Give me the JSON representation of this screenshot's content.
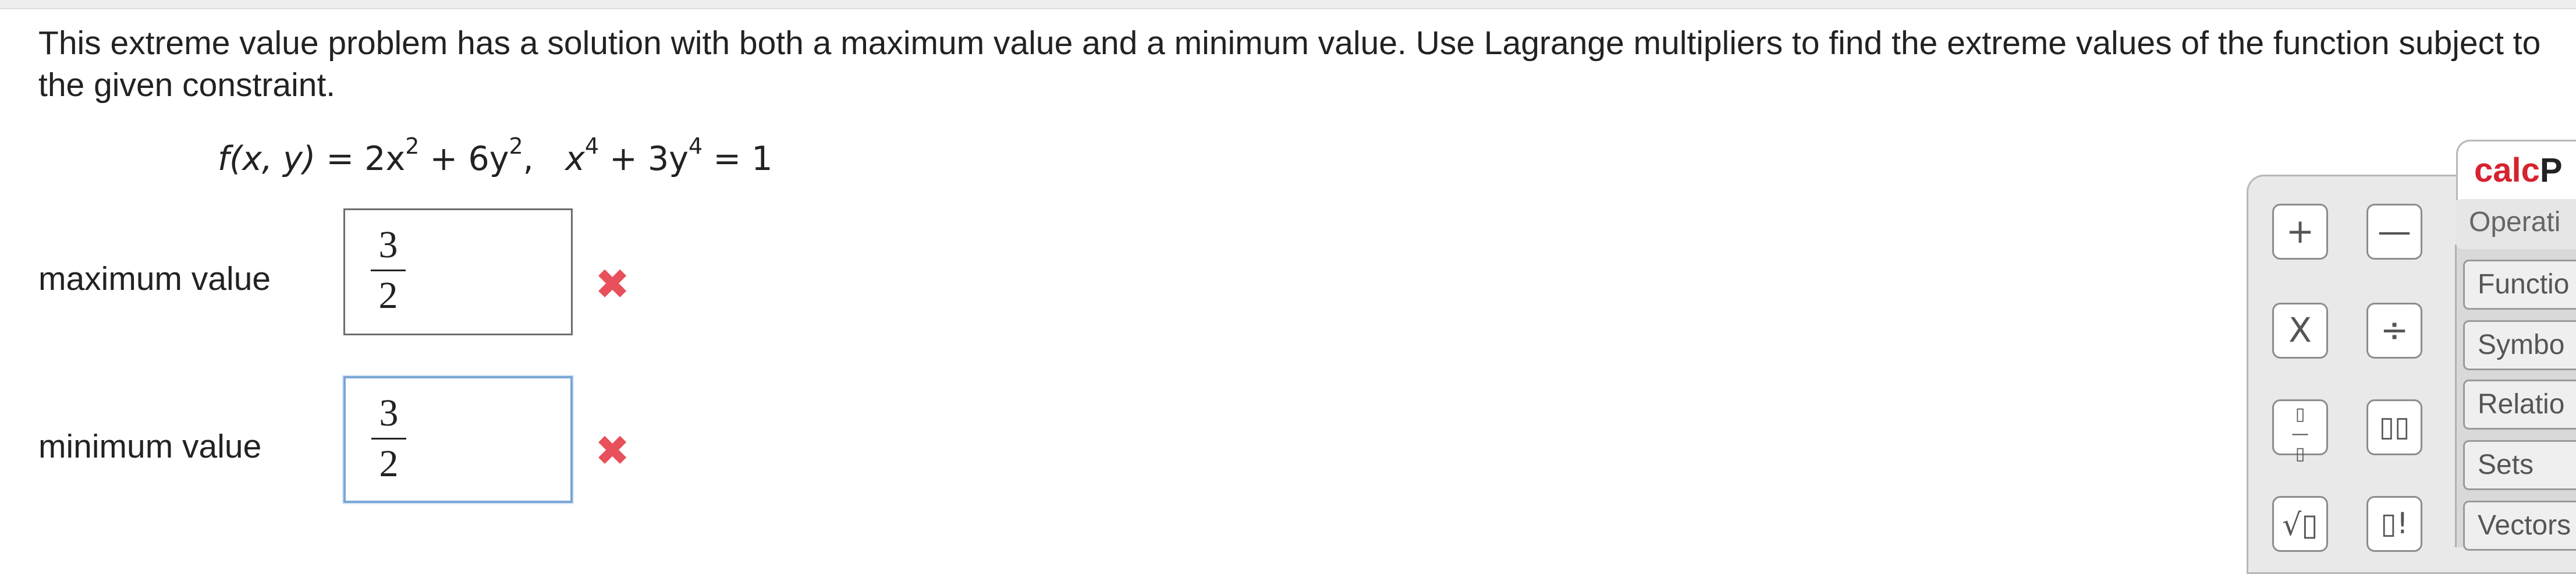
{
  "question": {
    "text": "This extreme value problem has a solution with both a maximum value and a minimum value. Use Lagrange multipliers to find the extreme values of the function subject to the given constraint."
  },
  "formula": {
    "lhs": "f(x, y)",
    "equals": " = ",
    "term1_coef": "2x",
    "term1_exp": "2",
    "plus": " + ",
    "term2_coef": "6y",
    "term2_exp": "2",
    "sep": ",   ",
    "c1": "x",
    "c1_exp": "4",
    "plus2": " + ",
    "c2": "3y",
    "c2_exp": "4",
    "c_eq": " = 1"
  },
  "answers": [
    {
      "label": "maximum value",
      "numerator": "3",
      "denominator": "2",
      "status": "incorrect",
      "mark": "✖"
    },
    {
      "label": "minimum value",
      "numerator": "3",
      "denominator": "2",
      "status": "incorrect",
      "mark": "✖"
    }
  ],
  "calcpad": {
    "title_red": "calc",
    "title_rest": "P",
    "buttons": [
      {
        "name": "plus",
        "glyph": "+"
      },
      {
        "name": "minus",
        "glyph": "—"
      },
      {
        "name": "times",
        "glyph": "X"
      },
      {
        "name": "divide",
        "glyph": "÷"
      },
      {
        "name": "fraction",
        "glyph": "▯"
      },
      {
        "name": "exponent",
        "glyph": "▯▯"
      },
      {
        "name": "sqrt",
        "glyph": "√▯"
      },
      {
        "name": "factorial",
        "glyph": "▯!"
      }
    ],
    "categories": [
      "Operati",
      "Functio",
      "Symbo",
      "Relatio",
      "Sets",
      "Vectors"
    ]
  },
  "colors": {
    "wrong_mark": "#e8505b",
    "focus_border": "#7aa6d6",
    "calc_red": "#d5232f"
  }
}
